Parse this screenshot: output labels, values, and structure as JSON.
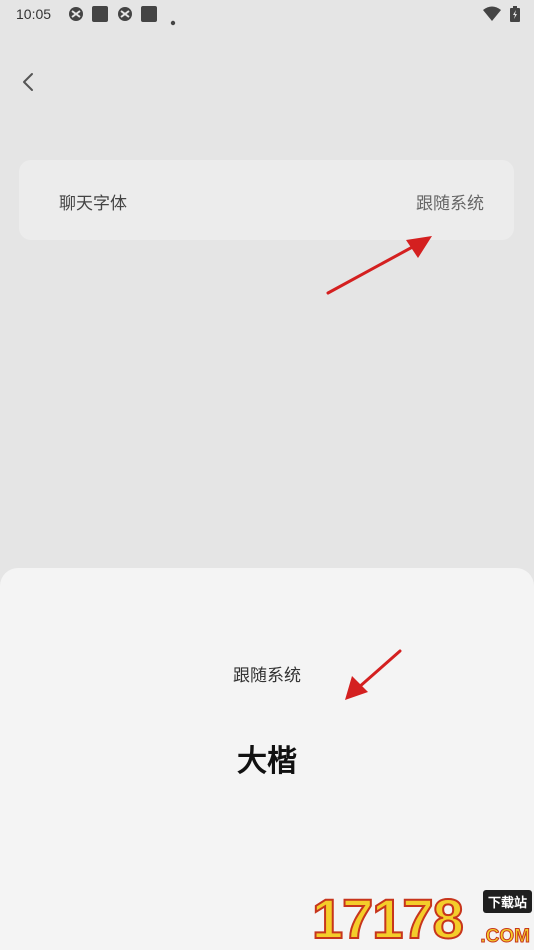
{
  "status_bar": {
    "time": "10:05",
    "left_icons": [
      "notification-app-icon",
      "notification-square-icon",
      "notification-app-icon",
      "notification-square-icon",
      "more-dot-icon"
    ],
    "right_icons": [
      "wifi-icon",
      "battery-icon"
    ]
  },
  "header": {
    "back_icon": "chevron-left-icon"
  },
  "setting": {
    "label": "聊天字体",
    "value": "跟随系统"
  },
  "font_sheet": {
    "options": [
      {
        "label": "跟随系统"
      },
      {
        "label": "大楷"
      }
    ]
  },
  "annotation_color": "#d42020",
  "watermark": {
    "digits": "17178",
    "tag": "下载站",
    "suffix": ".COM"
  }
}
